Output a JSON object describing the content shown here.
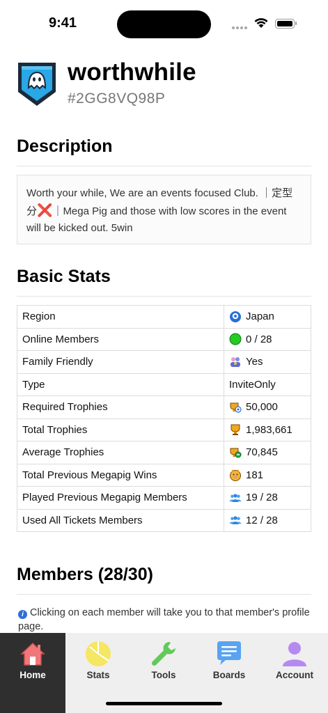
{
  "status_bar": {
    "time": "9:41"
  },
  "club": {
    "name": "worthwhile",
    "tag": "#2GG8VQ98P"
  },
  "sections": {
    "description_title": "Description",
    "basic_stats_title": "Basic Stats",
    "members_title": "Members (28/30)"
  },
  "description": {
    "part1": "Worth your while, We are an events focused Club. ｜定型分",
    "x_mark": "❌",
    "part2": "｜Mega Pig and those with low scores in the event will be kicked out. 5win"
  },
  "stats": [
    {
      "label": "Region",
      "value": "Japan",
      "icon": "location-pin-icon"
    },
    {
      "label": "Online Members",
      "value": "0 / 28",
      "icon": "green-dot-icon"
    },
    {
      "label": "Family Friendly",
      "value": "Yes",
      "icon": "family-icon"
    },
    {
      "label": "Type",
      "value": "InviteOnly",
      "icon": ""
    },
    {
      "label": "Required Trophies",
      "value": "50,000",
      "icon": "trophy-required-icon"
    },
    {
      "label": "Total Trophies",
      "value": "1,983,661",
      "icon": "trophy-icon"
    },
    {
      "label": "Average Trophies",
      "value": "70,845",
      "icon": "trophy-average-icon"
    },
    {
      "label": "Total Previous Megapig Wins",
      "value": "181",
      "icon": "megapig-icon"
    },
    {
      "label": "Played Previous Megapig Members",
      "value": "19 / 28",
      "icon": "people-icon"
    },
    {
      "label": "Used All Tickets Members",
      "value": "12 / 28",
      "icon": "people-icon"
    }
  ],
  "members": {
    "info_text": "Clicking on each member will take you to that member's profile page."
  },
  "tabs": [
    {
      "label": "Home",
      "icon": "home-icon",
      "active": true
    },
    {
      "label": "Stats",
      "icon": "pie-chart-icon",
      "active": false
    },
    {
      "label": "Tools",
      "icon": "wrench-icon",
      "active": false
    },
    {
      "label": "Boards",
      "icon": "chat-bubble-icon",
      "active": false
    },
    {
      "label": "Account",
      "icon": "person-icon",
      "active": false
    }
  ],
  "colors": {
    "badge_blue": "#29a7e6",
    "active_tab_bg": "#2f2f2f",
    "tab_bar_bg": "#efefef",
    "home_icon": "#f0787a",
    "stats_icon": "#f5e663",
    "tools_icon": "#62c95a",
    "boards_icon": "#59a3f0",
    "account_icon": "#b58af0"
  }
}
